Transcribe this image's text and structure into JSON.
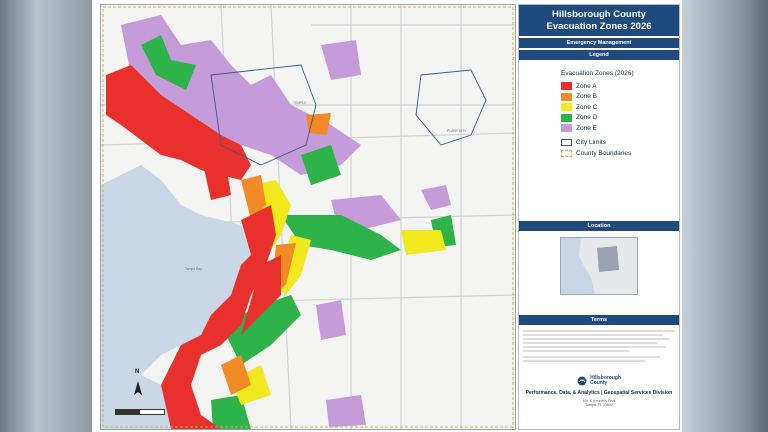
{
  "title": {
    "line1": "Hillsborough County",
    "line2": "Evacuation Zones 2026"
  },
  "department": "Emergency Management",
  "legend": {
    "header": "Legend",
    "title": "Evacuation Zones (2026)",
    "zones": [
      {
        "label": "Zone A",
        "color": "#e8302c"
      },
      {
        "label": "Zone B",
        "color": "#f28a26"
      },
      {
        "label": "Zone C",
        "color": "#f2e81e"
      },
      {
        "label": "Zone D",
        "color": "#2db34a"
      },
      {
        "label": "Zone E",
        "color": "#c69bd9"
      }
    ],
    "city_limits": "City Limits",
    "county_boundaries": "County Boundaries"
  },
  "location": {
    "header": "Location"
  },
  "terms": {
    "header": "Terms"
  },
  "logo": {
    "name_line1": "Hillsborough",
    "name_line2": "County"
  },
  "division": "Performance, Data, & Analytics | Geospatial Services Division",
  "address": {
    "line1": "601 E Kennedy Blvd",
    "line2": "Tampa, FL 33602"
  },
  "map_labels": {
    "tampa": "TEMPLE",
    "bay": "Tampa Bay",
    "plant_city": "PLANT CITY",
    "north": "N"
  },
  "colors": {
    "water": "#c9d7e6",
    "land": "#f4f4f2",
    "accent": "#1e4a7e",
    "city_limits": "#3a5a8a"
  }
}
